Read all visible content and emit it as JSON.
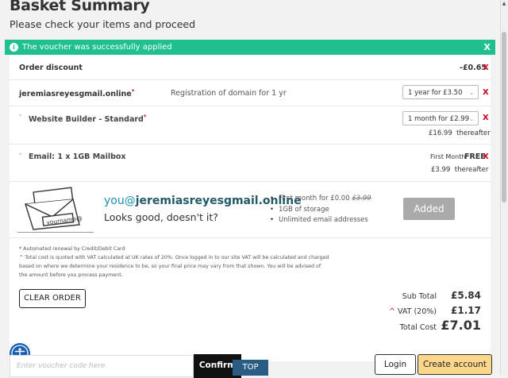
{
  "header": {
    "title": "Basket Summary",
    "subtitle": "Please check your items and proceed"
  },
  "alert": {
    "message": "The voucher was successfully applied",
    "close": "X"
  },
  "rows": {
    "discount": {
      "label": "Order discount",
      "amount": "-£0.65",
      "remove": "X"
    },
    "domain": {
      "name": "jeremiasreyesgmail.online",
      "asterisk": "*",
      "description": "Registration of domain for 1 yr",
      "select_value": "1 year for £3.50",
      "remove": "X"
    },
    "website_builder": {
      "name": "Website Builder - Standard",
      "asterisk": "*",
      "select_value": "1 month for £2.99",
      "after_price": "£16.99",
      "after_label": "thereafter",
      "remove": "X"
    },
    "email": {
      "name": "Email: 1 x 1GB Mailbox",
      "first_month_label": "First Month",
      "first_month_value": "FREE",
      "after_price": "£3.99",
      "after_label": "thereafter",
      "remove": "X"
    }
  },
  "promo": {
    "envelope_text": "yourname@",
    "email_prefix": "you@",
    "email_domain": "jeremiasreyesgmail.online",
    "tagline": "Looks good, doesn't it?",
    "bullet1_prefix": "First month for £0.00",
    "bullet1_old": "£3.99",
    "bullet2": "1GB of storage",
    "bullet3": "Unlimited email addresses",
    "added_button": "Added"
  },
  "footnotes": {
    "asterisk": "*",
    "line1": "Automated renewal by Credit/Debit Card",
    "line2": "^ Total cost is quoted with VAT calculated at UK rates of 20%. Once logged in to our site VAT will be calculated and charged",
    "line3": "based on where we determine your residence to be, so your final price may vary from that shown. You will be advised of",
    "line4": "the amount before you process payment."
  },
  "actions": {
    "clear_order": "CLEAR ORDER"
  },
  "totals": {
    "subtotal_label": "Sub Total",
    "subtotal_value": "£5.84",
    "vat_mark": "^",
    "vat_label": "VAT (20%)",
    "vat_value": "£1.17",
    "total_label": "Total Cost",
    "total_value": "£7.01"
  },
  "bottom": {
    "voucher_placeholder": "Enter voucher code here",
    "confirm": "Confirm",
    "top": "TOP",
    "login": "Login",
    "create_account": "Create account"
  },
  "icons": {
    "info": "i",
    "caret": "▾",
    "chevron": "⌄",
    "scroll_up": "▲",
    "expand": "˅"
  },
  "colors": {
    "success": "#1fbf8f",
    "remove": "#d0021b",
    "accent_blue": "#1b8fb3",
    "create_account_bg": "#fcd68a",
    "top_button_bg": "#2a5d84",
    "accessibility_bg": "#1a5fb4"
  }
}
